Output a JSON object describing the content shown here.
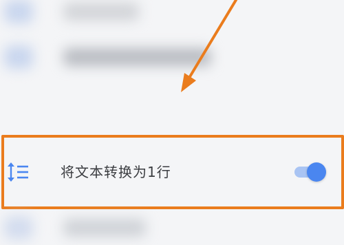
{
  "setting": {
    "label": "将文本转换为1行",
    "icon": "line-height-icon",
    "toggle_state": "on"
  },
  "colors": {
    "highlight": "#ea7c1d",
    "toggle_knob": "#4a86f0",
    "toggle_track": "#a9c4f3",
    "icon": "#4a86f0"
  }
}
